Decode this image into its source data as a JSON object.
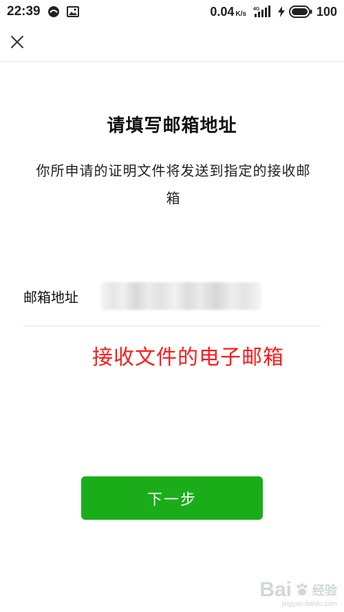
{
  "status_bar": {
    "time": "22:39",
    "net_speed": "0.04",
    "net_speed_unit": "K/s",
    "network_type": "4G",
    "battery": "100"
  },
  "header": {
    "close_icon": "close-icon"
  },
  "main": {
    "title": "请填写邮箱地址",
    "description": "你所申请的证明文件将发送到指定的接收邮箱",
    "email_label": "邮箱地址",
    "email_value": "",
    "annotation": "接收文件的电子邮箱",
    "next_button_label": "下一步"
  },
  "watermark": {
    "logo_text": "Bai",
    "logo_suffix": "经验",
    "sub_text": "jingyan.baidu.com"
  },
  "colors": {
    "accent_green": "#1aad19",
    "annotation_red": "#ff1a1a"
  }
}
